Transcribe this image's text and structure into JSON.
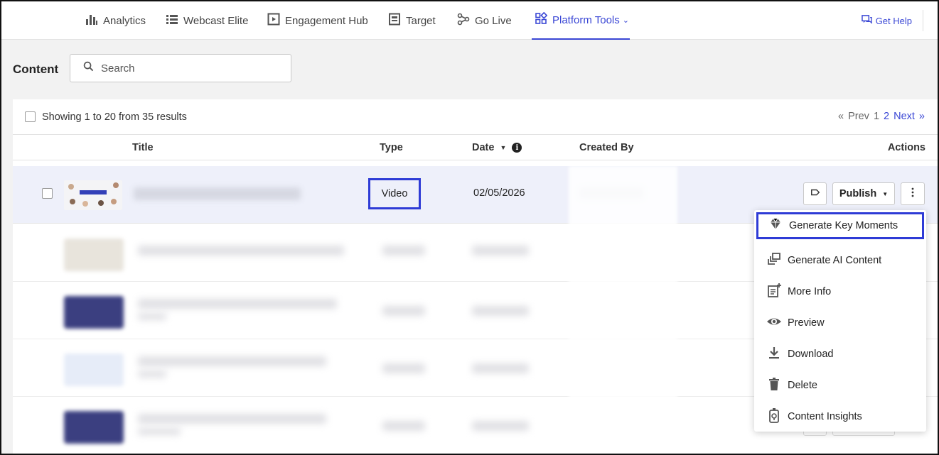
{
  "nav": {
    "items": [
      {
        "label": "Analytics",
        "icon": "bar-chart-icon"
      },
      {
        "label": "Webcast Elite",
        "icon": "list-icon"
      },
      {
        "label": "Engagement Hub",
        "icon": "hub-icon"
      },
      {
        "label": "Target",
        "icon": "target-icon"
      },
      {
        "label": "Go Live",
        "icon": "go-live-icon"
      },
      {
        "label": "Platform Tools",
        "icon": "grid-icon"
      }
    ],
    "help_label": "Get Help",
    "accent": "#3a47d5"
  },
  "content": {
    "label": "Content",
    "search_placeholder": "Search"
  },
  "results": {
    "text": "Showing 1 to 20 from 35 results",
    "pager": {
      "prev_symbol": "«",
      "prev": "Prev",
      "page1": "1",
      "page2": "2",
      "next": "Next",
      "next_symbol": "»"
    }
  },
  "table": {
    "headers": {
      "title": "Title",
      "type": "Type",
      "date": "Date",
      "created_by": "Created By",
      "actions": "Actions"
    },
    "rows": [
      {
        "type": "Video",
        "date": "02/05/2026"
      }
    ],
    "publish_label": "Publish"
  },
  "menu": {
    "items": [
      {
        "label": "Generate Key Moments",
        "icon": "gem-icon"
      },
      {
        "label": "Generate AI Content",
        "icon": "layers-icon"
      },
      {
        "label": "More Info",
        "icon": "info-doc-icon"
      },
      {
        "label": "Preview",
        "icon": "eye-icon"
      },
      {
        "label": "Download",
        "icon": "download-icon"
      },
      {
        "label": "Delete",
        "icon": "trash-icon"
      },
      {
        "label": "Content Insights",
        "icon": "insights-icon"
      }
    ],
    "highlight_color": "#2e3bd6"
  }
}
